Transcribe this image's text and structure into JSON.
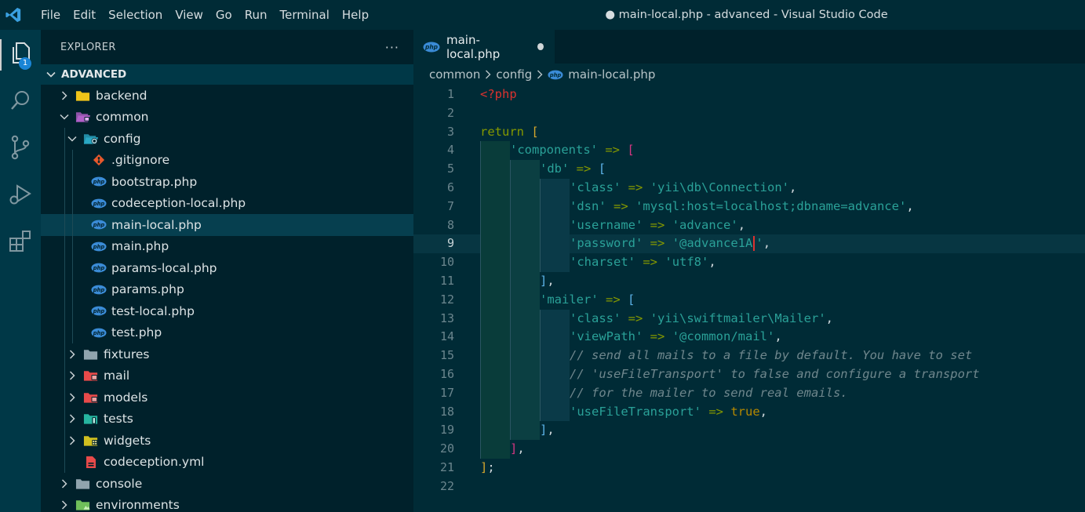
{
  "titlebar": {
    "logo": "vscode-logo-icon",
    "menu": [
      "File",
      "Edit",
      "Selection",
      "View",
      "Go",
      "Run",
      "Terminal",
      "Help"
    ],
    "title": "● main-local.php - advanced - Visual Studio Code"
  },
  "activitybar": {
    "items": [
      "explorer-icon",
      "search-icon",
      "source-control-icon",
      "run-debug-icon",
      "extensions-icon"
    ],
    "explorer_badge": "1"
  },
  "sidebar": {
    "title": "EXPLORER",
    "more": "···",
    "section": "ADVANCED",
    "tree": [
      {
        "label": "backend",
        "icon": "folder-icon",
        "color": "#f0c419",
        "chev": "right",
        "depth": 0
      },
      {
        "label": "common",
        "icon": "folder-open-icon",
        "color": "#b060c8",
        "chev": "down",
        "depth": 0
      },
      {
        "label": "config",
        "icon": "folder-config-icon",
        "color": "#2aa8c4",
        "chev": "down",
        "depth": 1
      },
      {
        "label": ".gitignore",
        "icon": "git-icon",
        "color": "#e8592c",
        "chev": "none",
        "depth": 2
      },
      {
        "label": "bootstrap.php",
        "icon": "php-icon",
        "color": "#3a8bd6",
        "chev": "none",
        "depth": 2
      },
      {
        "label": "codeception-local.php",
        "icon": "php-icon",
        "color": "#3a8bd6",
        "chev": "none",
        "depth": 2
      },
      {
        "label": "main-local.php",
        "icon": "php-icon",
        "color": "#3a8bd6",
        "chev": "none",
        "depth": 2,
        "selected": true
      },
      {
        "label": "main.php",
        "icon": "php-icon",
        "color": "#3a8bd6",
        "chev": "none",
        "depth": 2
      },
      {
        "label": "params-local.php",
        "icon": "php-icon",
        "color": "#3a8bd6",
        "chev": "none",
        "depth": 2
      },
      {
        "label": "params.php",
        "icon": "php-icon",
        "color": "#3a8bd6",
        "chev": "none",
        "depth": 2
      },
      {
        "label": "test-local.php",
        "icon": "php-icon",
        "color": "#3a8bd6",
        "chev": "none",
        "depth": 2
      },
      {
        "label": "test.php",
        "icon": "php-icon",
        "color": "#3a8bd6",
        "chev": "none",
        "depth": 2
      },
      {
        "label": "fixtures",
        "icon": "folder-icon",
        "color": "#90a4ae",
        "chev": "right",
        "depth": 1
      },
      {
        "label": "mail",
        "icon": "folder-mail-icon",
        "color": "#e84a4a",
        "chev": "right",
        "depth": 1
      },
      {
        "label": "models",
        "icon": "folder-models-icon",
        "color": "#e84a4a",
        "chev": "right",
        "depth": 1
      },
      {
        "label": "tests",
        "icon": "folder-tests-icon",
        "color": "#26b5a0",
        "chev": "right",
        "depth": 1
      },
      {
        "label": "widgets",
        "icon": "folder-widgets-icon",
        "color": "#d0c020",
        "chev": "right",
        "depth": 1
      },
      {
        "label": "codeception.yml",
        "icon": "yaml-file-icon",
        "color": "#e84a4a",
        "chev": "none",
        "depth": 1
      },
      {
        "label": "console",
        "icon": "folder-icon",
        "color": "#90a4ae",
        "chev": "right",
        "depth": 0
      },
      {
        "label": "environments",
        "icon": "folder-environment-icon",
        "color": "#6fbf5a",
        "chev": "right",
        "depth": 0
      }
    ]
  },
  "editor": {
    "tab": {
      "label": "main-local.php",
      "icon": "php-icon",
      "dirty": true
    },
    "breadcrumb": [
      "common",
      "config",
      "main-local.php"
    ],
    "current_line": 9,
    "lines": [
      {
        "n": "1",
        "indent": 0,
        "tokens": [
          [
            "<?php",
            "php"
          ]
        ]
      },
      {
        "n": "2",
        "indent": 0,
        "tokens": []
      },
      {
        "n": "3",
        "indent": 0,
        "tokens": [
          [
            "return",
            "kw"
          ],
          [
            " ",
            "punc"
          ],
          [
            "[",
            "b1"
          ]
        ]
      },
      {
        "n": "4",
        "indent": 1,
        "tokens": [
          [
            "'components'",
            "str"
          ],
          [
            " ",
            "punc"
          ],
          [
            "=>",
            "op"
          ],
          [
            " ",
            "punc"
          ],
          [
            "[",
            "b2"
          ]
        ]
      },
      {
        "n": "5",
        "indent": 2,
        "tokens": [
          [
            "'db'",
            "str"
          ],
          [
            " ",
            "punc"
          ],
          [
            "=>",
            "op"
          ],
          [
            " ",
            "punc"
          ],
          [
            "[",
            "b3"
          ]
        ]
      },
      {
        "n": "6",
        "indent": 3,
        "tokens": [
          [
            "'class'",
            "str"
          ],
          [
            " ",
            "punc"
          ],
          [
            "=>",
            "op"
          ],
          [
            " ",
            "punc"
          ],
          [
            "'yii\\db\\Connection'",
            "str"
          ],
          [
            ",",
            "punc"
          ]
        ]
      },
      {
        "n": "7",
        "indent": 3,
        "tokens": [
          [
            "'dsn'",
            "str"
          ],
          [
            " ",
            "punc"
          ],
          [
            "=>",
            "op"
          ],
          [
            " ",
            "punc"
          ],
          [
            "'mysql:host=localhost;dbname=advance'",
            "str"
          ],
          [
            ",",
            "punc"
          ]
        ]
      },
      {
        "n": "8",
        "indent": 3,
        "tokens": [
          [
            "'username'",
            "str"
          ],
          [
            " ",
            "punc"
          ],
          [
            "=>",
            "op"
          ],
          [
            " ",
            "punc"
          ],
          [
            "'advance'",
            "str"
          ],
          [
            ",",
            "punc"
          ]
        ]
      },
      {
        "n": "9",
        "indent": 3,
        "tokens": [
          [
            "'password'",
            "str"
          ],
          [
            " ",
            "punc"
          ],
          [
            "=>",
            "op"
          ],
          [
            " ",
            "punc"
          ],
          [
            "'@advance1A",
            "str"
          ],
          [
            "|",
            "cursor"
          ],
          [
            "'",
            "str"
          ],
          [
            ",",
            "punc"
          ]
        ]
      },
      {
        "n": "10",
        "indent": 3,
        "tokens": [
          [
            "'charset'",
            "str"
          ],
          [
            " ",
            "punc"
          ],
          [
            "=>",
            "op"
          ],
          [
            " ",
            "punc"
          ],
          [
            "'utf8'",
            "str"
          ],
          [
            ",",
            "punc"
          ]
        ]
      },
      {
        "n": "11",
        "indent": 2,
        "tokens": [
          [
            "]",
            "b3"
          ],
          [
            ",",
            "punc"
          ]
        ]
      },
      {
        "n": "12",
        "indent": 2,
        "tokens": [
          [
            "'mailer'",
            "str"
          ],
          [
            " ",
            "punc"
          ],
          [
            "=>",
            "op"
          ],
          [
            " ",
            "punc"
          ],
          [
            "[",
            "b3"
          ]
        ]
      },
      {
        "n": "13",
        "indent": 3,
        "tokens": [
          [
            "'class'",
            "str"
          ],
          [
            " ",
            "punc"
          ],
          [
            "=>",
            "op"
          ],
          [
            " ",
            "punc"
          ],
          [
            "'yii\\swiftmailer\\Mailer'",
            "str"
          ],
          [
            ",",
            "punc"
          ]
        ]
      },
      {
        "n": "14",
        "indent": 3,
        "tokens": [
          [
            "'viewPath'",
            "str"
          ],
          [
            " ",
            "punc"
          ],
          [
            "=>",
            "op"
          ],
          [
            " ",
            "punc"
          ],
          [
            "'@common/mail'",
            "str"
          ],
          [
            ",",
            "punc"
          ]
        ]
      },
      {
        "n": "15",
        "indent": 3,
        "tokens": [
          [
            "// send all mails to a file by default. You have to set",
            "cm"
          ]
        ]
      },
      {
        "n": "16",
        "indent": 3,
        "tokens": [
          [
            "// 'useFileTransport' to false and configure a transport",
            "cm"
          ]
        ]
      },
      {
        "n": "17",
        "indent": 3,
        "tokens": [
          [
            "// for the mailer to send real emails.",
            "cm"
          ]
        ]
      },
      {
        "n": "18",
        "indent": 3,
        "tokens": [
          [
            "'useFileTransport'",
            "str"
          ],
          [
            " ",
            "punc"
          ],
          [
            "=>",
            "op"
          ],
          [
            " ",
            "punc"
          ],
          [
            "true",
            "true"
          ],
          [
            ",",
            "punc"
          ]
        ]
      },
      {
        "n": "19",
        "indent": 2,
        "tokens": [
          [
            "]",
            "b3"
          ],
          [
            ",",
            "punc"
          ]
        ]
      },
      {
        "n": "20",
        "indent": 1,
        "tokens": [
          [
            "]",
            "b2"
          ],
          [
            ",",
            "punc"
          ]
        ]
      },
      {
        "n": "21",
        "indent": 0,
        "tokens": [
          [
            "]",
            "b1"
          ],
          [
            ";",
            "punc"
          ]
        ]
      },
      {
        "n": "22",
        "indent": 0,
        "tokens": []
      }
    ]
  }
}
